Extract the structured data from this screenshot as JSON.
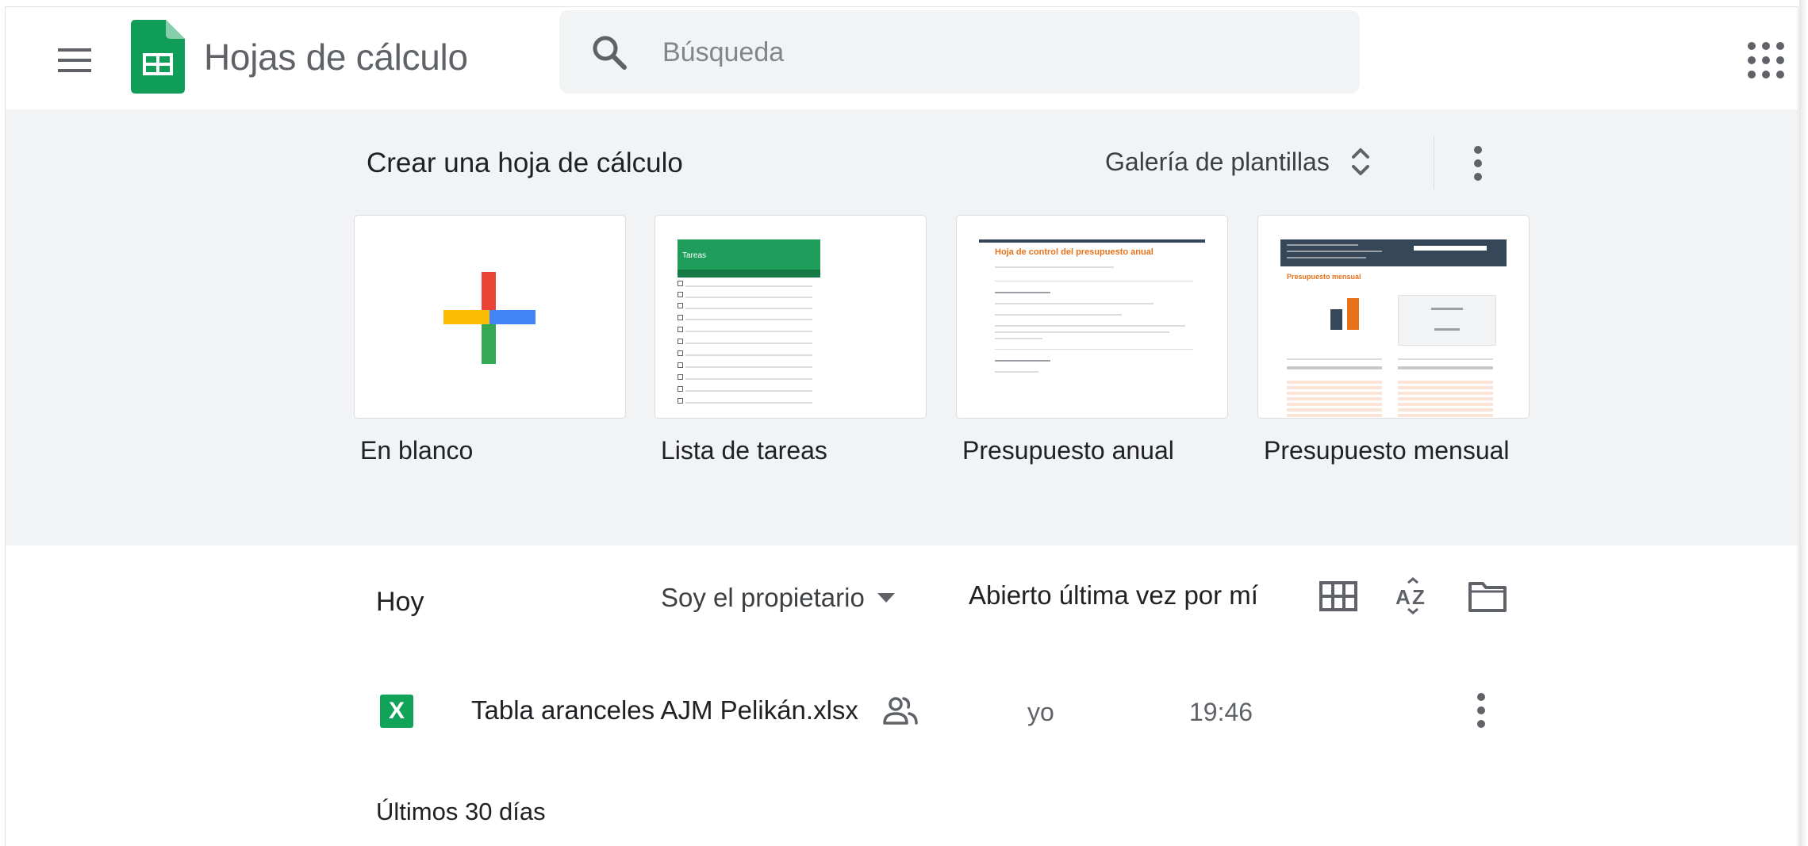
{
  "header": {
    "app_title": "Hojas de cálculo",
    "search": {
      "placeholder": "Búsqueda"
    },
    "icons": [
      "menu-icon",
      "sheets-logo-icon",
      "search-icon",
      "apps-grid-icon"
    ]
  },
  "templates": {
    "heading": "Crear una hoja de cálculo",
    "gallery_label": "Galería de plantillas",
    "items": [
      {
        "label": "En blanco"
      },
      {
        "label": "Lista de tareas",
        "preview_title": "Tareas"
      },
      {
        "label": "Presupuesto anual",
        "preview_title": "Hoja de control del presupuesto anual"
      },
      {
        "label": "Presupuesto mensual",
        "preview_title": "Presupuesto mensual"
      }
    ]
  },
  "files": {
    "section_today": "Hoy",
    "owner_filter": "Soy el propietario",
    "sort_label": "Abierto última vez por mí",
    "rows": [
      {
        "name": "Tabla aranceles AJM Pelikán.xlsx",
        "owner": "yo",
        "time": "19:46",
        "shared": true,
        "file_icon_letter": "X"
      }
    ],
    "section_30": "Últimos 30 días"
  },
  "colors": {
    "sheets_green": "#0f9d58",
    "excel_green": "#11a35a",
    "template_bg": "#f1f3f4",
    "accent_orange": "#e8711a",
    "dark_navy": "#37475a"
  }
}
